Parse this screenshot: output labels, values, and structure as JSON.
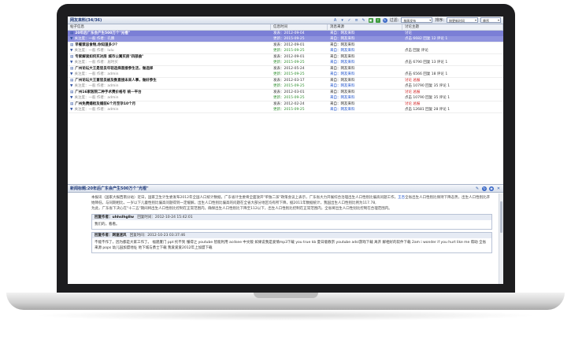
{
  "top_pane": {
    "title": "网友来料(34/36)",
    "filter_label": "过滤:",
    "filter_value": "按周发布",
    "sort_label": "排序:",
    "sort_value": "按更新时间",
    "op_value": "降序",
    "columns": [
      "帖子信息",
      "信息时间",
      "消息来源",
      "讨论主题"
    ],
    "rows": [
      {
        "subject": "20年后广东会产生500万个\"光棍\"",
        "poster": "关注度：一般  作者：孔鹏",
        "time1": "发表：2012-09-04",
        "time2": "更新：2015-09-25",
        "source1": "来自：网友来料",
        "source2": "来自：网友来料",
        "topic1": "讨论",
        "topic2": "点击 6682 回复 12 评论 1",
        "selected": true
      },
      {
        "subject": "早餐禁忌食物,你知道多少？",
        "poster": "关注度：一般  作者：lulu",
        "time1": "发表：2012-09-01",
        "time2": "更新：2015-09-25",
        "source1": "来自：网友来料",
        "source2": "来自：网友来料",
        "topic1": "",
        "topic2": "点击 回复 评论",
        "selected": false
      },
      {
        "subject": "专家解读如何买对房 城市公寓买房\"四部曲\"",
        "poster": "关注度：一般  作者：居时买",
        "time1": "发表：2012-09-01",
        "time2": "更新：2015-09-25",
        "source1": "来自：网友来料",
        "source2": "来自：网友来料",
        "topic1": "",
        "topic2": "点击 6790 回复 13 评论 1",
        "selected": false
      },
      {
        "subject": "广州论坛大王是官员年轻选择直接参生活，做选择",
        "poster": "关注度：一般  作者：admin",
        "time1": "发表：2012-05-24",
        "time2": "更新：2015-09-25",
        "source1": "来自：网友来料",
        "source2": "来自：网友来料",
        "topic1": "",
        "topic2": "点击 6566 回复 18 评论 1",
        "selected": false
      },
      {
        "subject": "广州论坛大王意官员被及数直接未来人事，做好参生",
        "poster": "关注度：一般  作者：admin",
        "time1": "发表：2012-03-17",
        "time2": "更新：2015-09-25",
        "source1": "来自：网友来料",
        "source2": "来自：网友来料",
        "topic1": "讨论 总报",
        "topic2": "点击 10790 回复 35 评论 1",
        "selected": false
      },
      {
        "subject": "广州16家医院二种手术费价格号 统一平台",
        "poster": "关注度：一般  作者：admin",
        "time1": "发表：2012-03-01",
        "time2": "更新：2015-09-25",
        "source1": "来自：网友来料",
        "source2": "来自：网友来料",
        "topic1": "讨论 总报",
        "topic2": "点击 10790 回复 35 评论 1",
        "selected": false
      },
      {
        "subject": "广州免费婚检及婚前6个月至孕10个月",
        "poster": "关注度：一般  作者：admin",
        "time1": "发表：2012-02-24",
        "time2": "更新：2015-09-25",
        "source1": "来自：网友来料",
        "source2": "来自：网友来料",
        "topic1": "讨论 总报",
        "topic2": "点击 12681 回复 28 评论 1",
        "selected": false
      }
    ]
  },
  "bottom_pane": {
    "title": "新闻标题:20年后广东会产生500万个\"光棍\"",
    "article_p1": "本报讯（国家大报西南分站）近日，国家卫生计生委发布2012年全国人口统计数据，广东省计生委将全面放开\"单独二孩\"政策会议上表示，广东省大力开展综合治理出生人口性别比偏高问题工作，",
    "article_highlight": "王杏",
    "article_p1b": "全省出生人口性别比保持下降态势，出生人口性别比开始降低，与同期相比，一岁以下儿童性别比偏高问题得到一定缓解，出生人口性别比偏高的问题在全省大部分地区均有所下降，据2011年数据统计，我国出生人口性别比例为117.78,",
    "article_p2": "为此，广东省下决心在\"十二五\"期间将出生人口性别比控制在正常范围内，确保出生人口性别比下降至112以下，出生人口性别比控制在正常范围内，全省将出生人口性别比控制在合理范围内。",
    "reply1_author": "回复作者：uhhslhg8w",
    "reply1_time": "回复时间：2012-10-24 15:42:01",
    "reply1_body": "我们的，看看。",
    "reply2_author": "回复作者：网速迷风",
    "reply2_time": "回复时间：2012-10-23 03:37:46",
    "reply2_body": "不能不作了，因为都是大家工作了。 福建厦门 ppt 托不到 懂得之 youtube 智能利用 acdsee 中文版 如果说我是爱情mp3下载 you true kb 夏日版教宗 youtube adsl游戏下载 离开 解相好的软件下载 2am i wonder if you hurt like me 帮助 全省来源 pops 幼儿园加盟地址 地下城与勇士下载 我爱爱爱2012年上加盟下载"
  }
}
